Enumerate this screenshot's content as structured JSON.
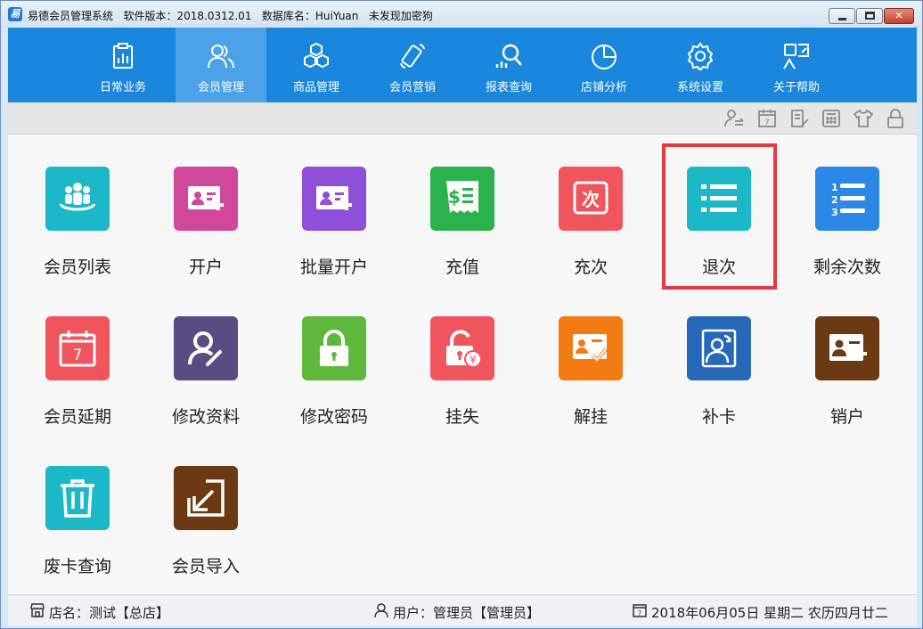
{
  "titlebar": {
    "app_name": "易德会员管理系统",
    "version_label": "软件版本：2018.0312.01",
    "db_label": "数据库名：HuiYuan",
    "encrypt_label": "未发现加密狗"
  },
  "nav": {
    "items": [
      {
        "label": "日常业务",
        "icon": "clipboard-chart-icon"
      },
      {
        "label": "会员管理",
        "icon": "members-icon",
        "active": true
      },
      {
        "label": "商品管理",
        "icon": "cubes-icon"
      },
      {
        "label": "会员营销",
        "icon": "phone-icon"
      },
      {
        "label": "报表查询",
        "icon": "report-search-icon"
      },
      {
        "label": "店铺分析",
        "icon": "pie-chart-icon"
      },
      {
        "label": "系统设置",
        "icon": "gear-icon"
      },
      {
        "label": "关于帮助",
        "icon": "help-icon"
      }
    ]
  },
  "toolbar": {
    "icons": [
      "user-transfer-icon",
      "calendar-icon",
      "edit-list-icon",
      "calculator-icon",
      "shirt-icon",
      "lock-icon"
    ]
  },
  "tiles": [
    {
      "label": "会员列表",
      "color": "#1cb8c8",
      "icon": "member-list-icon"
    },
    {
      "label": "开户",
      "color": "#d0489b",
      "icon": "open-account-icon"
    },
    {
      "label": "批量开户",
      "color": "#8f4fd8",
      "icon": "batch-open-icon"
    },
    {
      "label": "充值",
      "color": "#2bb24c",
      "icon": "recharge-icon"
    },
    {
      "label": "充次",
      "color": "#f0555e",
      "icon": "recharge-times-icon"
    },
    {
      "label": "退次",
      "color": "#1cb8c8",
      "icon": "refund-times-icon"
    },
    {
      "label": "剩余次数",
      "color": "#2b88e6",
      "icon": "remaining-times-icon"
    },
    {
      "label": "会员延期",
      "color": "#f0555e",
      "icon": "calendar-extend-icon"
    },
    {
      "label": "修改资料",
      "color": "#5a4b82",
      "icon": "edit-profile-icon"
    },
    {
      "label": "修改密码",
      "color": "#5db83c",
      "icon": "padlock-icon"
    },
    {
      "label": "挂失",
      "color": "#f0555e",
      "icon": "report-loss-icon"
    },
    {
      "label": "解挂",
      "color": "#f27b14",
      "icon": "unlock-card-icon"
    },
    {
      "label": "补卡",
      "color": "#2569b8",
      "icon": "replace-card-icon"
    },
    {
      "label": "销户",
      "color": "#6b3a12",
      "icon": "close-account-icon"
    },
    {
      "label": "废卡查询",
      "color": "#1cb8c8",
      "icon": "trash-icon"
    },
    {
      "label": "会员导入",
      "color": "#6b3a12",
      "icon": "import-icon"
    }
  ],
  "status": {
    "store": "店名：测试【总店】",
    "user": "用户：管理员【管理员】",
    "date": "2018年06月05日 星期二 农历四月廿二"
  },
  "colors": {
    "nav_bg": "#1a86dc",
    "nav_active": "#4ba2e9",
    "highlight": "#e8393e"
  }
}
